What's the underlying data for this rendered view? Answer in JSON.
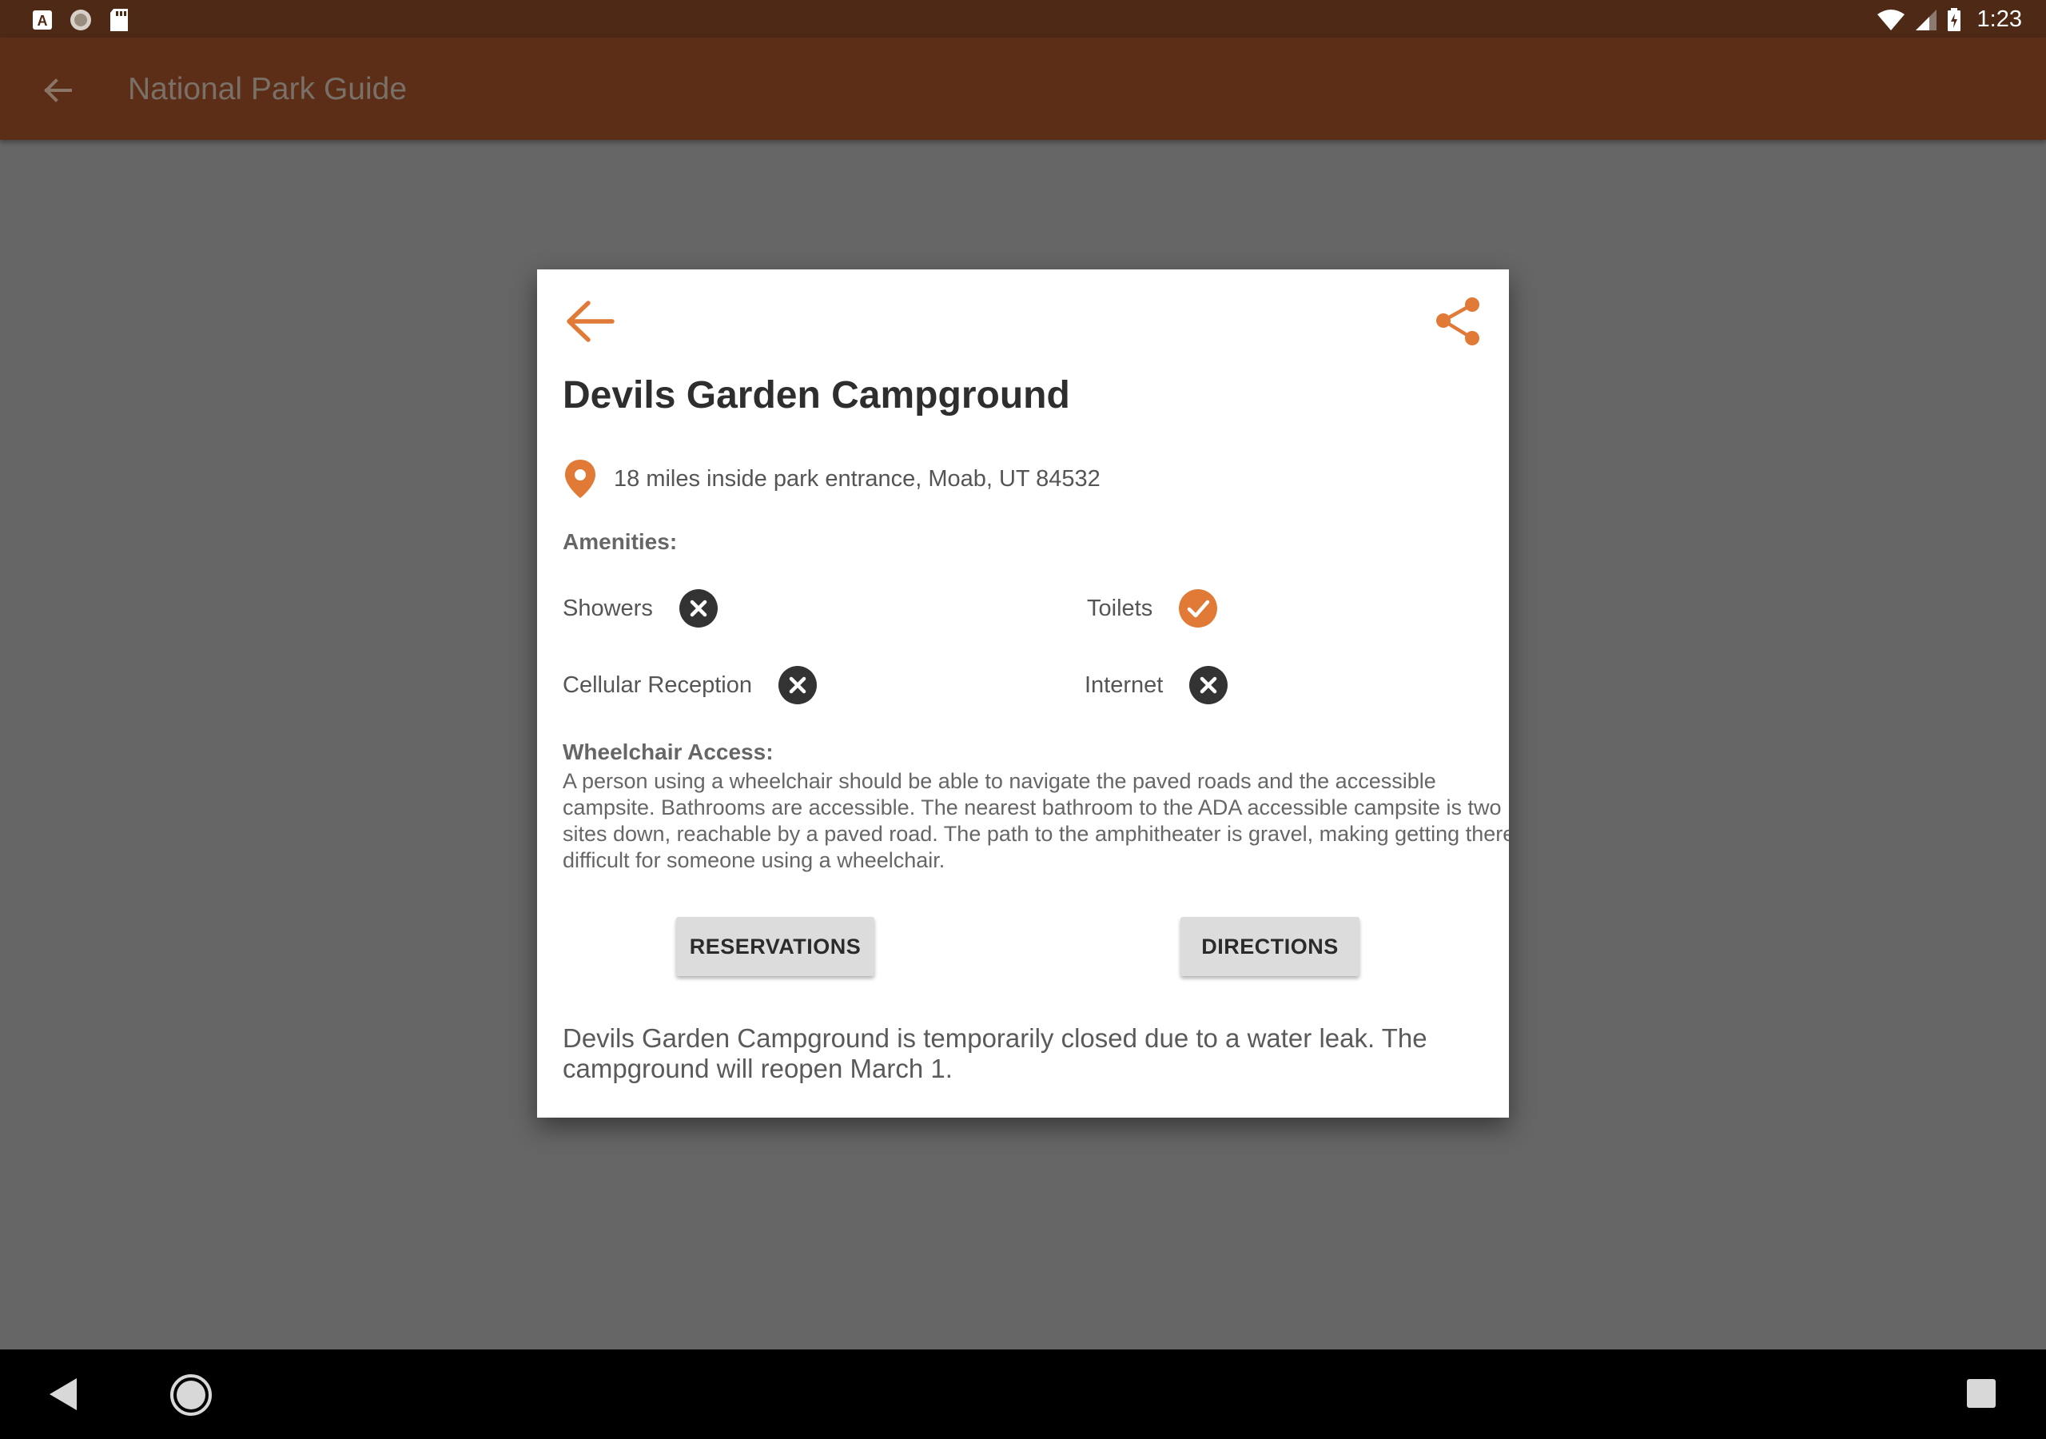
{
  "status_bar": {
    "time": "1:23",
    "left_icons": [
      "app-a-icon",
      "sync-circle-icon",
      "sd-card-icon"
    ],
    "right_icons": [
      "wifi-icon",
      "signal-icon",
      "battery-charging-icon"
    ]
  },
  "app_bar": {
    "title": "National Park Guide",
    "back_icon": "arrow-back-icon"
  },
  "dialog": {
    "title": "Devils Garden Campground",
    "address": "18 miles inside park entrance, Moab, UT 84532",
    "amenities_label": "Amenities:",
    "amenities": [
      {
        "name": "Showers",
        "available": false
      },
      {
        "name": "Toilets",
        "available": true
      },
      {
        "name": "Cellular Reception",
        "available": false
      },
      {
        "name": "Internet",
        "available": false
      }
    ],
    "wheelchair_label": "Wheelchair Access:",
    "wheelchair_text": "A person using a wheelchair should be able to navigate the paved roads and the accessible campsite. Bathrooms are accessible. The nearest bathroom to the ADA accessible campsite is two sites down, reachable by a paved road. The path to the amphitheater is gravel, making getting there difficult for someone using a wheelchair.",
    "reservations_label": "RESERVATIONS",
    "directions_label": "DIRECTIONS",
    "notice": "Devils Garden Campground is temporarily closed due to a water leak. The campground will reopen March 1."
  },
  "colors": {
    "accent": "#e07a36",
    "status_bar": "#4e2915",
    "app_bar": "#5c2e17",
    "scrim": "#666666",
    "unavailable_icon": "#333333"
  }
}
